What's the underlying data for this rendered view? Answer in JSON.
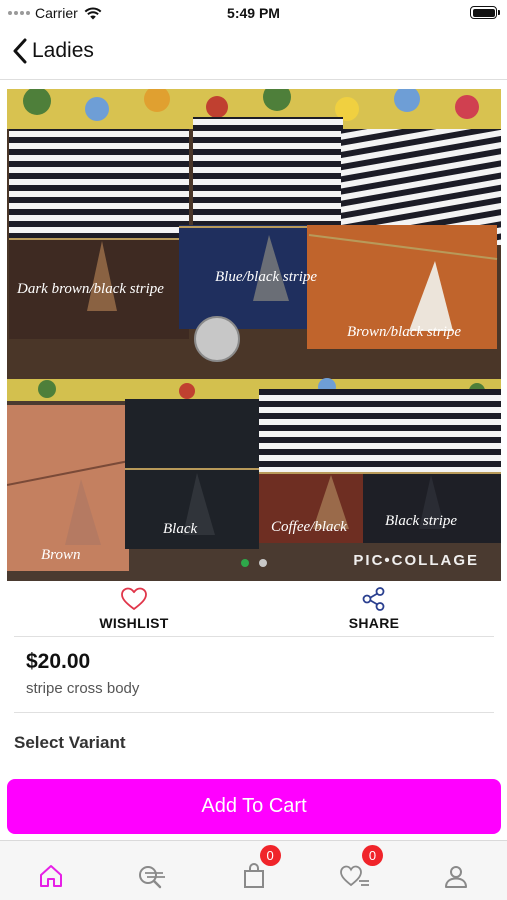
{
  "status_bar": {
    "carrier": "Carrier",
    "time": "5:49 PM"
  },
  "nav": {
    "back_title": "Ladies"
  },
  "product_image": {
    "variant_labels": [
      "Dark brown/black stripe",
      "Blue/black stripe",
      "Brown/black stripe",
      "Brown",
      "Black",
      "Coffee/black",
      "Black stripe"
    ],
    "watermark": "PIC•COLLAGE",
    "page_count": 2,
    "active_page": 1
  },
  "actions": {
    "wishlist_label": "WISHLIST",
    "share_label": "SHARE"
  },
  "product": {
    "price": "$20.00",
    "name": "stripe cross body"
  },
  "variants": {
    "title": "Select Variant"
  },
  "cart_button": {
    "label": "Add To Cart",
    "color": "#ff00ff"
  },
  "tab_bar": {
    "active_color": "#e620e6",
    "items": [
      {
        "icon": "home-icon"
      },
      {
        "icon": "search-list-icon"
      },
      {
        "icon": "shopping-bag-icon",
        "badge": "0"
      },
      {
        "icon": "heart-list-icon",
        "badge": "0"
      },
      {
        "icon": "user-icon"
      }
    ]
  },
  "colors": {
    "badge": "#f0242a",
    "wishlist_heart": "#e0364a",
    "share": "#2a3f8f"
  }
}
